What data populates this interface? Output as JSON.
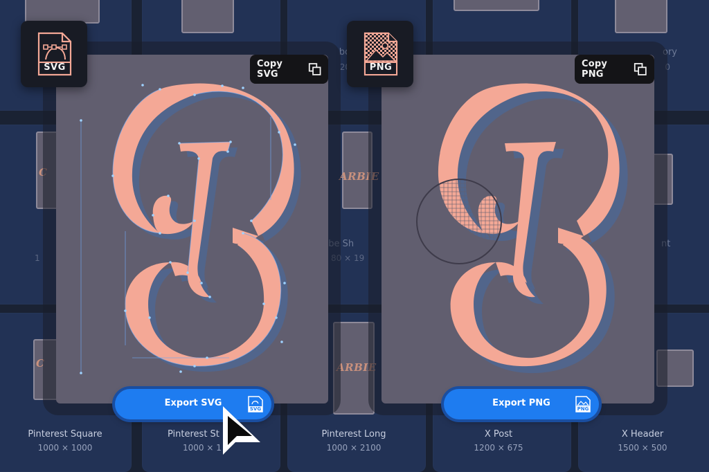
{
  "templates": [
    {
      "name": "Pinterest Square",
      "size": "1000 × 1000"
    },
    {
      "name": "Pinterest St",
      "size": "1000 × 1"
    },
    {
      "name": "Pinterest Long",
      "size": "1000 × 2100"
    },
    {
      "name": "X Post",
      "size": "1200 × 675"
    },
    {
      "name": "X Header",
      "size": "1500 × 500"
    }
  ],
  "partial": {
    "mid_left": "ube Sh",
    "mid_left_size": "80 × 19",
    "mid_right": "nt",
    "mid_left_edge": "1",
    "top_b": "bo",
    "top_b_size": "20",
    "top_right": "ory",
    "top_right_size": "0",
    "thumb_text": "ARBIE",
    "thumb_text_left": "C"
  },
  "svg_card": {
    "badge_label": "SVG",
    "copy_label": "Copy SVG",
    "export_label": "Export SVG",
    "export_icon_label": "SVG"
  },
  "png_card": {
    "badge_label": "PNG",
    "copy_label": "Copy PNG",
    "export_label": "Export PNG",
    "export_icon_label": "PNG"
  },
  "colors": {
    "letter": "#f4a896",
    "card_bg": "#615e6f",
    "accent_blue": "#1e7cf0",
    "anchor_point": "#8ec5ff"
  }
}
